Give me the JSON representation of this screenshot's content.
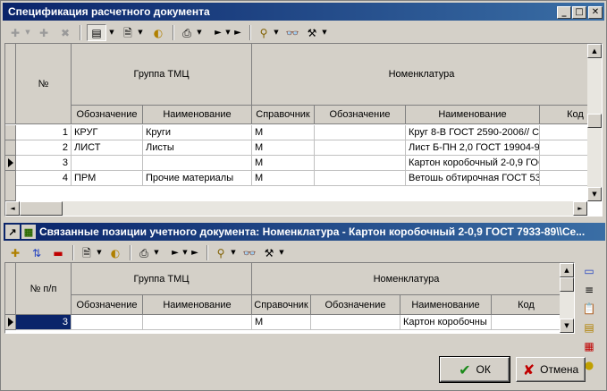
{
  "window": {
    "title": "Спецификация расчетного документа",
    "min_glyph": "_",
    "max_glyph": "□",
    "close_glyph": "✕"
  },
  "top_toolbar": [
    {
      "name": "add-icon",
      "glyph": "✚",
      "disabled": true
    },
    {
      "name": "insert-icon",
      "glyph": "✚",
      "disabled": true
    },
    {
      "name": "delete-icon",
      "glyph": "✖",
      "disabled": true
    },
    {
      "name": "view-icon",
      "glyph": "▤",
      "disabled": false
    },
    {
      "name": "document-icon",
      "glyph": "🗎",
      "disabled": false
    },
    {
      "name": "filter-icon",
      "glyph": "◐",
      "disabled": false
    },
    {
      "name": "print-icon",
      "glyph": "⎙",
      "disabled": false
    },
    {
      "name": "play-icon",
      "glyph": "►",
      "disabled": false
    },
    {
      "name": "next-icon",
      "glyph": "►",
      "disabled": false
    },
    {
      "name": "funnel-icon",
      "glyph": "⚲",
      "disabled": false
    },
    {
      "name": "binoculars-icon",
      "glyph": "👓",
      "disabled": false
    },
    {
      "name": "tools-icon",
      "glyph": "⚒",
      "disabled": false
    }
  ],
  "top_grid": {
    "headers": {
      "num": "№",
      "group": "Группа ТМЦ",
      "nomenclature": "Номенклатура",
      "group_code": "Обозначение",
      "group_name": "Наименование",
      "ref": "Справочник",
      "nom_code": "Обозначение",
      "nom_name": "Наименование",
      "code": "Код"
    },
    "rows": [
      {
        "num": "1",
        "group_code": "КРУГ",
        "group_name": "Круги",
        "ref": "М",
        "nom_code": "",
        "nom_name": "Круг 8-В ГОСТ 2590-2006// С",
        "current": false
      },
      {
        "num": "2",
        "group_code": "ЛИСТ",
        "group_name": "Листы",
        "ref": "М",
        "nom_code": "",
        "nom_name": "Лист Б-ПН 2,0 ГОСТ 19904-9",
        "current": false
      },
      {
        "num": "3",
        "group_code": "",
        "group_name": "",
        "ref": "М",
        "nom_code": "",
        "nom_name": "Картон коробочный 2-0,9 ГОС",
        "current": true
      },
      {
        "num": "4",
        "group_code": "ПРМ",
        "group_name": "Прочие материалы",
        "ref": "М",
        "nom_code": "",
        "nom_name": "Ветошь обтирочная ГОСТ 53",
        "current": false
      }
    ]
  },
  "sub_panel": {
    "title": "Связанные позиции учетного документа: Номенклатура - Картон коробочный 2-0,9 ГОСТ 7933-89\\\\Се...",
    "pin_glyph": "↗",
    "icon_glyph": "▦"
  },
  "bottom_grid": {
    "headers": {
      "num": "№ п/п",
      "group": "Группа ТМЦ",
      "nomenclature": "Номенклатура",
      "group_code": "Обозначение",
      "group_name": "Наименование",
      "ref": "Справочник",
      "nom_code": "Обозначение",
      "nom_name": "Наименование",
      "code": "Код"
    },
    "rows": [
      {
        "num": "3",
        "group_code": "",
        "group_name": "",
        "ref": "М",
        "nom_code": "",
        "nom_name": "Картон коробочны",
        "code": ""
      }
    ]
  },
  "buttons": {
    "ok": "ОК",
    "cancel": "Отмена",
    "ok_glyph": "✔",
    "cancel_glyph": "✘"
  },
  "colors": {
    "title_start": "#0a246a",
    "title_end": "#3a6ea5",
    "selected_cell": "#0a246a",
    "ok_check": "#1a8a1a",
    "cancel_x": "#c00000"
  }
}
